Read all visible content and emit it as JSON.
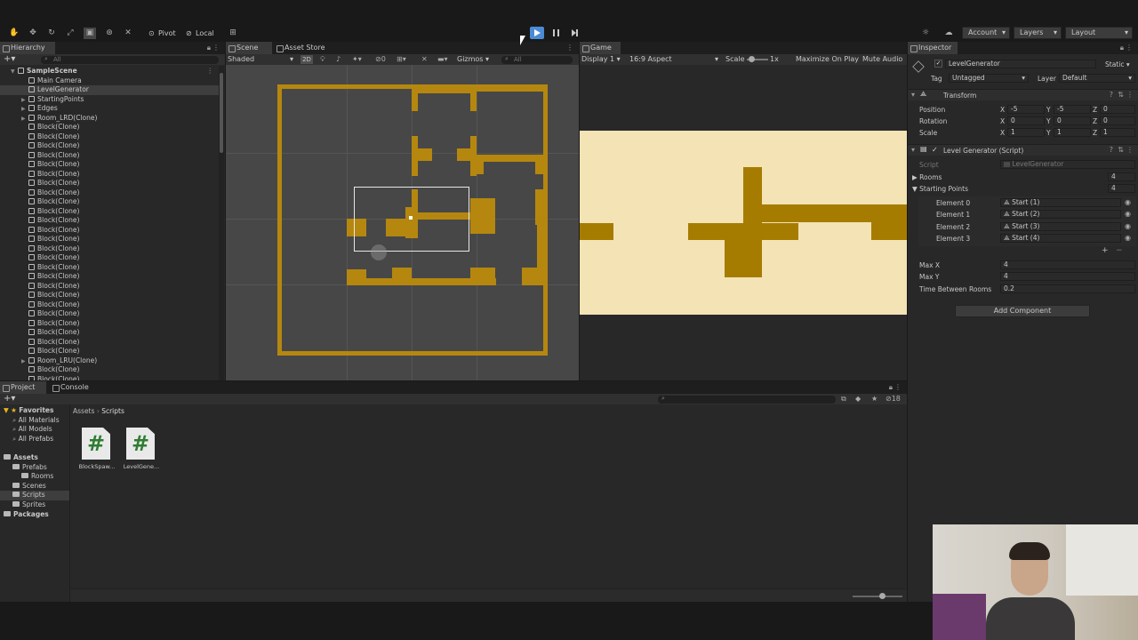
{
  "toolbar": {
    "pivot": "Pivot",
    "local": "Local",
    "account": "Account",
    "layers": "Layers",
    "layout": "Layout"
  },
  "hierarchy": {
    "tab": "Hierarchy",
    "search_placeholder": "All",
    "items": [
      {
        "label": "SampleScene",
        "indent": 0,
        "expand": "▼",
        "kind": "scene"
      },
      {
        "label": "Main Camera",
        "indent": 1,
        "expand": "",
        "kind": "obj"
      },
      {
        "label": "LevelGenerator",
        "indent": 1,
        "expand": "",
        "kind": "obj",
        "selected": true
      },
      {
        "label": "StartingPoints",
        "indent": 1,
        "expand": "▶",
        "kind": "obj"
      },
      {
        "label": "Edges",
        "indent": 1,
        "expand": "▶",
        "kind": "obj"
      },
      {
        "label": "Room_LRD(Clone)",
        "indent": 1,
        "expand": "▶",
        "kind": "obj"
      },
      {
        "label": "Block(Clone)",
        "indent": 1,
        "expand": "",
        "kind": "obj"
      },
      {
        "label": "Block(Clone)",
        "indent": 1,
        "expand": "",
        "kind": "obj"
      },
      {
        "label": "Block(Clone)",
        "indent": 1,
        "expand": "",
        "kind": "obj"
      },
      {
        "label": "Block(Clone)",
        "indent": 1,
        "expand": "",
        "kind": "obj"
      },
      {
        "label": "Block(Clone)",
        "indent": 1,
        "expand": "",
        "kind": "obj"
      },
      {
        "label": "Block(Clone)",
        "indent": 1,
        "expand": "",
        "kind": "obj"
      },
      {
        "label": "Block(Clone)",
        "indent": 1,
        "expand": "",
        "kind": "obj"
      },
      {
        "label": "Block(Clone)",
        "indent": 1,
        "expand": "",
        "kind": "obj"
      },
      {
        "label": "Block(Clone)",
        "indent": 1,
        "expand": "",
        "kind": "obj"
      },
      {
        "label": "Block(Clone)",
        "indent": 1,
        "expand": "",
        "kind": "obj"
      },
      {
        "label": "Block(Clone)",
        "indent": 1,
        "expand": "",
        "kind": "obj"
      },
      {
        "label": "Block(Clone)",
        "indent": 1,
        "expand": "",
        "kind": "obj"
      },
      {
        "label": "Block(Clone)",
        "indent": 1,
        "expand": "",
        "kind": "obj"
      },
      {
        "label": "Block(Clone)",
        "indent": 1,
        "expand": "",
        "kind": "obj"
      },
      {
        "label": "Block(Clone)",
        "indent": 1,
        "expand": "",
        "kind": "obj"
      },
      {
        "label": "Block(Clone)",
        "indent": 1,
        "expand": "",
        "kind": "obj"
      },
      {
        "label": "Block(Clone)",
        "indent": 1,
        "expand": "",
        "kind": "obj"
      },
      {
        "label": "Block(Clone)",
        "indent": 1,
        "expand": "",
        "kind": "obj"
      },
      {
        "label": "Block(Clone)",
        "indent": 1,
        "expand": "",
        "kind": "obj"
      },
      {
        "label": "Block(Clone)",
        "indent": 1,
        "expand": "",
        "kind": "obj"
      },
      {
        "label": "Block(Clone)",
        "indent": 1,
        "expand": "",
        "kind": "obj"
      },
      {
        "label": "Block(Clone)",
        "indent": 1,
        "expand": "",
        "kind": "obj"
      },
      {
        "label": "Block(Clone)",
        "indent": 1,
        "expand": "",
        "kind": "obj"
      },
      {
        "label": "Block(Clone)",
        "indent": 1,
        "expand": "",
        "kind": "obj"
      },
      {
        "label": "Block(Clone)",
        "indent": 1,
        "expand": "",
        "kind": "obj"
      },
      {
        "label": "Room_LRU(Clone)",
        "indent": 1,
        "expand": "▶",
        "kind": "obj"
      },
      {
        "label": "Block(Clone)",
        "indent": 1,
        "expand": "",
        "kind": "obj"
      },
      {
        "label": "Block(Clone)",
        "indent": 1,
        "expand": "",
        "kind": "obj"
      }
    ]
  },
  "scene": {
    "tab_scene": "Scene",
    "tab_asset_store": "Asset Store",
    "shading": "Shaded",
    "mode_2d": "2D",
    "gizmos": "Gizmos",
    "search_placeholder": "All"
  },
  "game": {
    "tab": "Game",
    "display": "Display 1",
    "aspect": "16:9 Aspect",
    "scale_label": "Scale",
    "scale_value": "1x",
    "maximize": "Maximize On Play",
    "mute": "Mute Audio"
  },
  "inspector": {
    "tab": "Inspector",
    "object_name": "LevelGenerator",
    "static": "Static",
    "tag_label": "Tag",
    "tag_value": "Untagged",
    "layer_label": "Layer",
    "layer_value": "Default",
    "transform": {
      "title": "Transform",
      "position_label": "Position",
      "rotation_label": "Rotation",
      "scale_label": "Scale",
      "position": {
        "x": "-5",
        "y": "-5",
        "z": "0"
      },
      "rotation": {
        "x": "0",
        "y": "0",
        "z": "0"
      },
      "scale": {
        "x": "1",
        "y": "1",
        "z": "1"
      }
    },
    "script_component": {
      "title": "Level Generator (Script)",
      "script_label": "Script",
      "script_value": "LevelGenerator",
      "rooms_label": "Rooms",
      "rooms_value": "4",
      "starting_points_label": "Starting Points",
      "starting_points_value": "4",
      "elements": [
        {
          "label": "Element 0",
          "value": "Start (1)"
        },
        {
          "label": "Element 1",
          "value": "Start (2)"
        },
        {
          "label": "Element 2",
          "value": "Start (3)"
        },
        {
          "label": "Element 3",
          "value": "Start (4)"
        }
      ],
      "max_x_label": "Max X",
      "max_x_value": "4",
      "max_y_label": "Max Y",
      "max_y_value": "4",
      "time_label": "Time Between Rooms",
      "time_value": "0.2"
    },
    "add_component": "Add Component"
  },
  "project": {
    "tab_project": "Project",
    "tab_console": "Console",
    "breadcrumb_root": "Assets",
    "breadcrumb_current": "Scripts",
    "hidden_count": "18",
    "tree": [
      {
        "label": "Favorites",
        "indent": 0,
        "type": "star"
      },
      {
        "label": "All Materials",
        "indent": 1,
        "type": "search"
      },
      {
        "label": "All Models",
        "indent": 1,
        "type": "search"
      },
      {
        "label": "All Prefabs",
        "indent": 1,
        "type": "search"
      },
      {
        "label": "",
        "indent": 0,
        "type": "spacer"
      },
      {
        "label": "Assets",
        "indent": 0,
        "type": "folder"
      },
      {
        "label": "Prefabs",
        "indent": 1,
        "type": "folder"
      },
      {
        "label": "Rooms",
        "indent": 2,
        "type": "folder"
      },
      {
        "label": "Scenes",
        "indent": 1,
        "type": "folder"
      },
      {
        "label": "Scripts",
        "indent": 1,
        "type": "folder",
        "selected": true
      },
      {
        "label": "Sprites",
        "indent": 1,
        "type": "folder"
      },
      {
        "label": "Packages",
        "indent": 0,
        "type": "folder"
      }
    ],
    "files": [
      {
        "label": "BlockSpaw...",
        "glyph": "#"
      },
      {
        "label": "LevelGene...",
        "glyph": "#"
      }
    ]
  },
  "icons": {
    "play": "play-icon",
    "pause": "pause-icon",
    "step": "step-icon",
    "script": "csharp-script-icon"
  },
  "colors": {
    "scene_blocks": "#b5870f",
    "game_blocks": "#a67c00",
    "game_background": "#f3e3b5",
    "play_active": "#4b8bd6"
  }
}
